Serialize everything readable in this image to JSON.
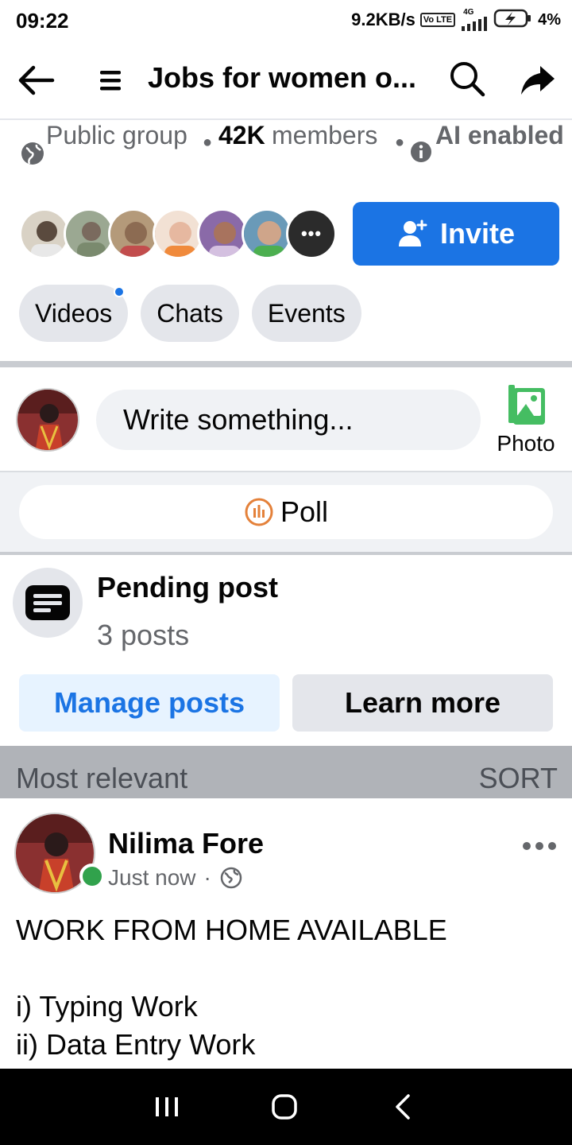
{
  "status_bar": {
    "time": "09:22",
    "network_speed": "9.2KB/s",
    "volte_label": "Vo LTE",
    "signal_label": "4G",
    "battery_percent": "4%"
  },
  "header": {
    "title": "Jobs for women o..."
  },
  "group_info": {
    "privacy": "Public group",
    "member_count": "42K",
    "member_label": "members",
    "ai_label": "AI enabled"
  },
  "members": {
    "avatar_colors": [
      "#5a4a3e",
      "#7a8a6e",
      "#8c6b52",
      "#e6b8a0",
      "#a8735e",
      "#cfa58a",
      "#2b2b2b"
    ],
    "more_label": "•••"
  },
  "invite": {
    "label": "Invite"
  },
  "chips": [
    {
      "label": "Videos",
      "has_dot": true
    },
    {
      "label": "Chats",
      "has_dot": false
    },
    {
      "label": "Events",
      "has_dot": false
    }
  ],
  "composer": {
    "placeholder": "Write something...",
    "photo_label": "Photo",
    "poll_label": "Poll"
  },
  "pending": {
    "title": "Pending post",
    "count": "3 posts",
    "manage_label": "Manage posts",
    "learn_label": "Learn more"
  },
  "feed": {
    "sort_label": "Most relevant",
    "sort_button": "SORT"
  },
  "post": {
    "author": "Nilima Fore",
    "time": "Just now",
    "separator": "·",
    "audience_icon": "globe-icon",
    "lines": [
      "WORK FROM HOME AVAILABLE",
      "",
      "i) Typing Work",
      "ii) Data Entry Work"
    ]
  },
  "colors": {
    "brand_blue": "#1b74e4",
    "online_green": "#31a24c",
    "photo_green": "#45bd62",
    "poll_orange": "#e4813a"
  }
}
